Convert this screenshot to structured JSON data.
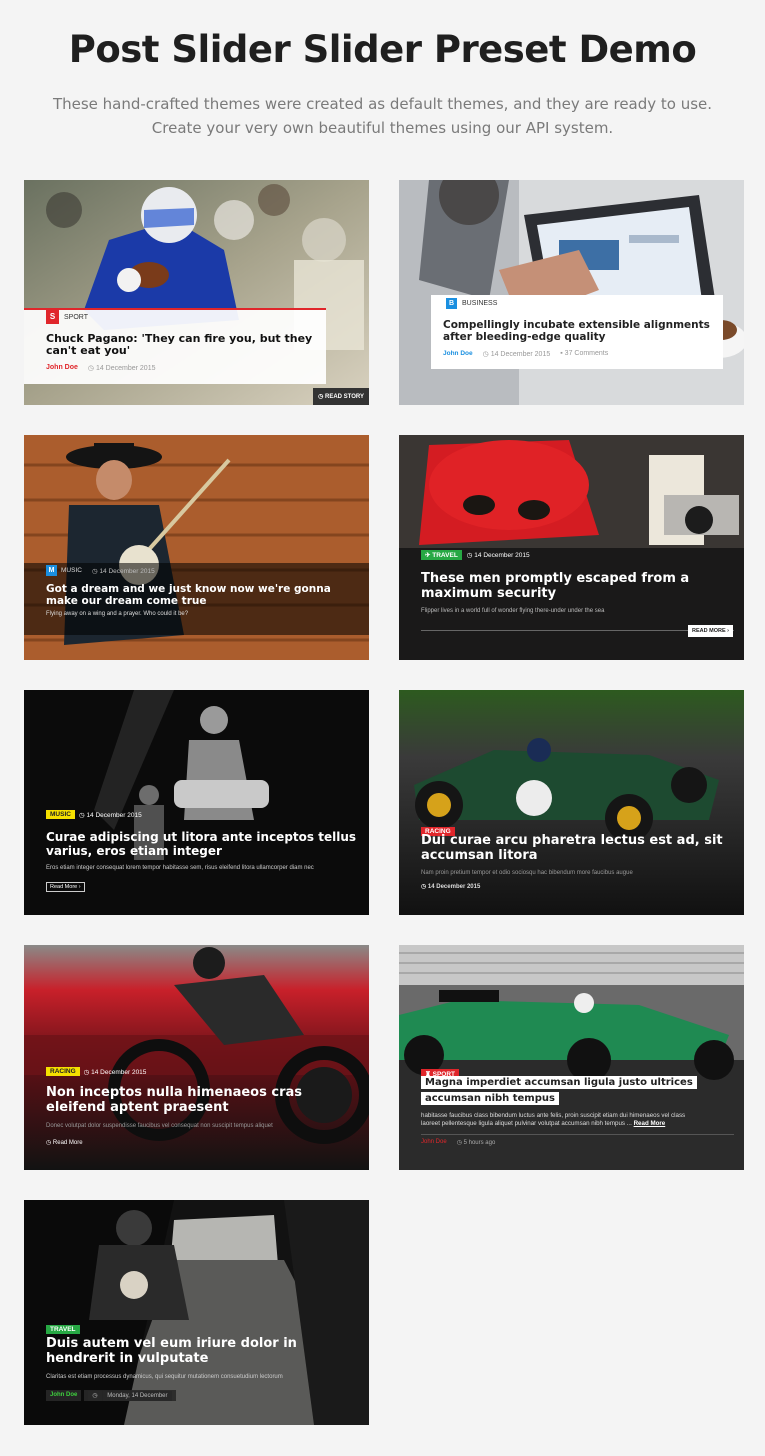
{
  "header": {
    "title": "Post Slider Slider Preset Demo",
    "subtitle_line1": "These hand-crafted themes were created as default themes, and they are ready to use.",
    "subtitle_line2": "Create your very own beautiful themes using our API system."
  },
  "colors": {
    "sport_red": "#e0262b",
    "business_blue": "#1a8fe0",
    "music_yellow": "#f5e000",
    "travel_green": "#27a844",
    "page_bg": "#f4f4f4"
  },
  "cards": [
    {
      "category_initial": "S",
      "category": "SPORT",
      "title": "Chuck Pagano: 'They can fire you, but they can't eat you'",
      "author": "John Doe",
      "date": "14 December 2015",
      "button": "READ STORY"
    },
    {
      "category_initial": "B",
      "category": "BUSINESS",
      "title": "Compellingly incubate extensible alignments after bleeding-edge quality",
      "author": "John Doe",
      "date": "14 December 2015",
      "comments": "37 Comments"
    },
    {
      "category_initial": "M",
      "category": "MUSIC",
      "date": "14 December 2015",
      "title": "Got a dream and we just know now we're gonna make our dream come true",
      "excerpt": "Flying away on a wing and a prayer. Who could it be?"
    },
    {
      "category": "TRAVEL",
      "date": "14 December 2015",
      "title": "These men promptly escaped from a maximum security",
      "excerpt": "Flipper lives in a world full of wonder flying there-under under the sea",
      "button": "READ MORE"
    },
    {
      "category": "MUSIC",
      "date": "14 December 2015",
      "title": "Curae adipiscing ut litora ante inceptos tellus varius, eros etiam integer",
      "excerpt": "Eros etiam integer consequat lorem tempor habitasse sem, risus eleifend litora ullamcorper diam nec",
      "button": "Read More"
    },
    {
      "category": "RACING",
      "title": "Dui curae arcu pharetra lectus est ad, sit accumsan litora",
      "excerpt": "Nam proin pretium tempor et odio sociosqu hac bibendum more faucibus augue",
      "date": "14 December 2015"
    },
    {
      "category": "RACING",
      "date": "14 December 2015",
      "title": "Non inceptos nulla himenaeos cras eleifend aptent praesent",
      "excerpt": "Donec volutpat dolor suspendisse faucibus vel consequat non suscipit tempus aliquet",
      "button": "Read More"
    },
    {
      "category": "SPORT",
      "title_line1": "Magna imperdiet accumsan ligula justo ultrices",
      "title_line2": "accumsan nibh tempus",
      "excerpt_line1": "habitasse faucibus class bibendum luctus ante felis, proin suscipit etiam dui himenaeos vel class",
      "excerpt_line2": "laoreet pellentesque ligula aliquet pulvinar volutpat accumsan nibh tempus ...",
      "button": "Read More",
      "author": "John Doe",
      "date": "5 hours ago"
    },
    {
      "category": "TRAVEL",
      "title": "Duis autem vel eum iriure dolor in hendrerit in vulputate",
      "excerpt": "Claritas est etiam processus dynamicus, qui sequitur mutationem consuetudium lectorum",
      "author": "John Doe",
      "date": "Monday, 14 December"
    }
  ]
}
